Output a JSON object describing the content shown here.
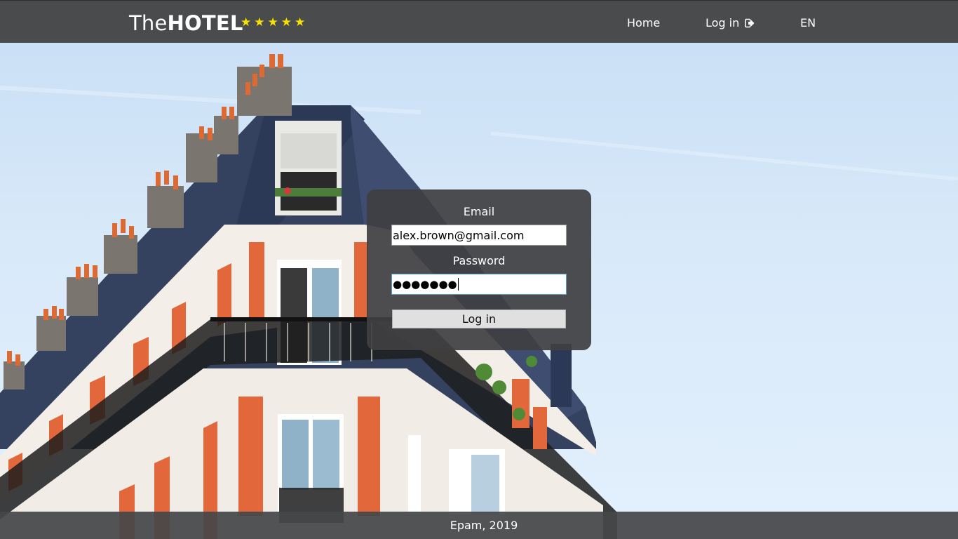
{
  "header": {
    "brand_prefix": "The",
    "brand_bold": "HOTEL",
    "rating_stars": "★★★★★",
    "nav": {
      "home": "Home",
      "login": "Log in",
      "language": "EN"
    }
  },
  "login_form": {
    "email_label": "Email",
    "email_value": "alex.brown@gmail.com",
    "password_label": "Password",
    "password_masked": "●●●●●●●",
    "submit_label": "Log in"
  },
  "footer": {
    "text": "Epam, 2019"
  },
  "colors": {
    "header_bg": "#4a4b4d",
    "star_color": "#f7e000",
    "panel_bg": "#404042",
    "sky": "#d8e9f9",
    "facade_orange": "#e06a3e",
    "roof_slate": "#3b4a6a"
  },
  "icons": {
    "login": "sign-in-icon",
    "stars": "star-icon"
  }
}
